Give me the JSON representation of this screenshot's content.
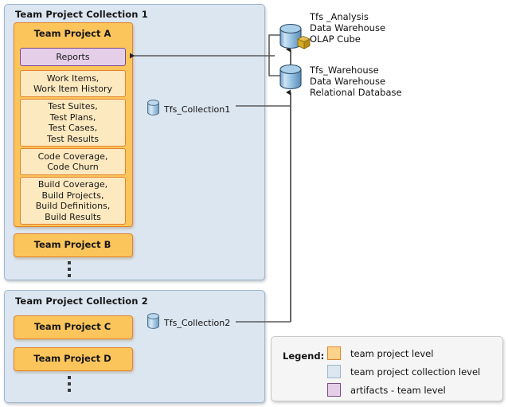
{
  "diagram": {
    "title_internal": "Team Foundation Server data warehouse architecture"
  },
  "collections": [
    {
      "name": "collection-1",
      "title": "Team Project Collection 1",
      "db_label": "Tfs_Collection1",
      "db_icon": "database-cylinder-icon",
      "projects": [
        {
          "name": "team-project-a",
          "title": "Team Project A",
          "reports": "Reports",
          "artifacts": [
            "Work Items,\nWork Item History",
            "Test Suites,\nTest Plans,\nTest Cases,\nTest Results",
            "Code Coverage,\nCode Churn",
            "Build Coverage,\nBuild Projects,\nBuild Definitions,\nBuild Results"
          ]
        },
        {
          "name": "team-project-b",
          "title": "Team Project B",
          "reports": null,
          "artifacts": []
        }
      ],
      "ellipsis": "vertical-ellipsis"
    },
    {
      "name": "collection-2",
      "title": "Team Project Collection 2",
      "db_label": "Tfs_Collection2",
      "db_icon": "database-cylinder-icon",
      "projects": [
        {
          "name": "team-project-c",
          "title": "Team Project C",
          "reports": null,
          "artifacts": []
        },
        {
          "name": "team-project-d",
          "title": "Team Project D",
          "reports": null,
          "artifacts": []
        }
      ],
      "ellipsis": "vertical-ellipsis"
    }
  ],
  "warehouses": [
    {
      "name": "tfs-analysis",
      "icon": "database-cylinder-icon",
      "extra_icon": "olap-cube-icon",
      "line1": "Tfs _Analysis",
      "line2": "Data Warehouse",
      "line3": "OLAP Cube"
    },
    {
      "name": "tfs-warehouse",
      "icon": "database-cylinder-icon",
      "extra_icon": null,
      "line1": "Tfs_Warehouse",
      "line2": "Data Warehouse",
      "line3": "Relational Database"
    }
  ],
  "legend": {
    "title": "Legend:",
    "items": [
      {
        "label": "team project level",
        "fill": "#fcd28a",
        "stroke": "#e2822c"
      },
      {
        "label": "team project collection level",
        "fill": "#dce6f0",
        "stroke": "#9fb6cd"
      },
      {
        "label": "artifacts - team level",
        "fill": "#e5cfe8",
        "stroke": "#7d4a8c"
      }
    ]
  },
  "colors": {
    "project_fill": "#fcc55c",
    "project_stroke": "#e2822c",
    "artifact_fill": "#fde9c0",
    "collection_fill": "#dce6f0",
    "collection_stroke": "#9fb6cd",
    "reports_fill": "#e5cfe8",
    "reports_stroke": "#7d4a8c",
    "connector": "#5a5a5a",
    "arrow": "#1a1a1a",
    "cube": "#d4a017"
  }
}
